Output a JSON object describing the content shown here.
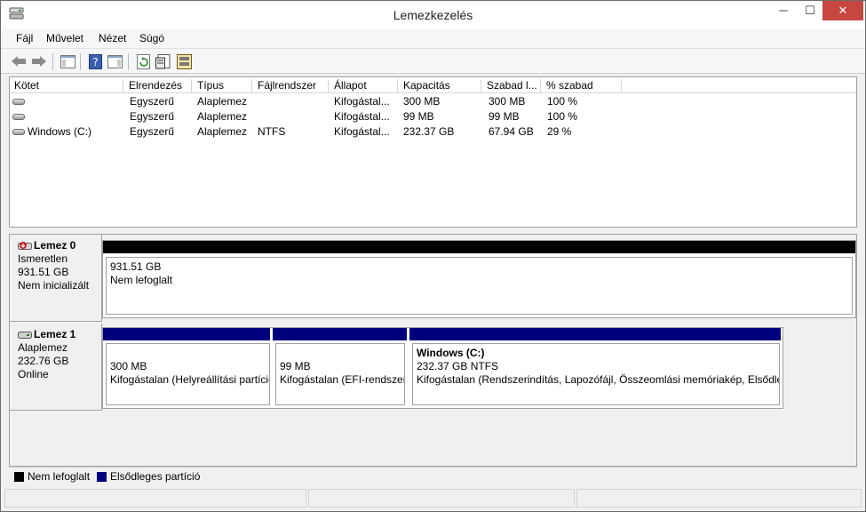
{
  "window": {
    "title": "Lemezkezelés"
  },
  "menu": [
    {
      "label": "Fájl"
    },
    {
      "label": "Művelet"
    },
    {
      "label": "Nézet"
    },
    {
      "label": "Súgó"
    }
  ],
  "volumes": {
    "columns": [
      "Kötet",
      "Elrendezés",
      "Típus",
      "Fájlrendszer",
      "Állapot",
      "Kapacitás",
      "Szabad l...",
      "% szabad"
    ],
    "rows": [
      {
        "volume": "",
        "layout": "Egyszerű",
        "type": "Alaplemez",
        "fs": "",
        "status": "Kifogástal...",
        "capacity": "300 MB",
        "free": "300 MB",
        "pct": "100 %"
      },
      {
        "volume": "",
        "layout": "Egyszerű",
        "type": "Alaplemez",
        "fs": "",
        "status": "Kifogástal...",
        "capacity": "99 MB",
        "free": "99 MB",
        "pct": "100 %"
      },
      {
        "volume": "Windows (C:)",
        "layout": "Egyszerű",
        "type": "Alaplemez",
        "fs": "NTFS",
        "status": "Kifogástal...",
        "capacity": "232.37 GB",
        "free": "67.94 GB",
        "pct": "29 %"
      }
    ]
  },
  "disks": [
    {
      "name": "Lemez 0",
      "kind": "Ismeretlen",
      "size": "931.51 GB",
      "state": "Nem inicializált",
      "partitions": [
        {
          "title": "",
          "line1": "931.51 GB",
          "line2": "Nem lefoglalt",
          "color": "#000000"
        }
      ]
    },
    {
      "name": "Lemez 1",
      "kind": "Alaplemez",
      "size": "232.76 GB",
      "state": "Online",
      "partitions": [
        {
          "title": "",
          "line1": "300 MB",
          "line2": "Kifogástalan (Helyreállítási partíció)",
          "color": "#00007d"
        },
        {
          "title": "",
          "line1": "99 MB",
          "line2": "Kifogástalan (EFI-rendszerpartíció)",
          "color": "#00007d"
        },
        {
          "title": "Windows  (C:)",
          "line1": "232.37 GB NTFS",
          "line2": "Kifogástalan (Rendszerindítás, Lapozófájl, Összeomlási memóriakép, Elsődleges partíció)",
          "color": "#00007d"
        }
      ]
    }
  ],
  "legend": [
    {
      "label": "Nem lefoglalt",
      "color": "#000000"
    },
    {
      "label": "Elsődleges partíció",
      "color": "#00007d"
    }
  ],
  "icons": [
    "app-icon",
    "back-arrow-icon",
    "forward-arrow-icon",
    "console-tree-icon",
    "help-icon",
    "action-pane-icon",
    "refresh-icon",
    "properties-icon",
    "rescan-icon"
  ]
}
